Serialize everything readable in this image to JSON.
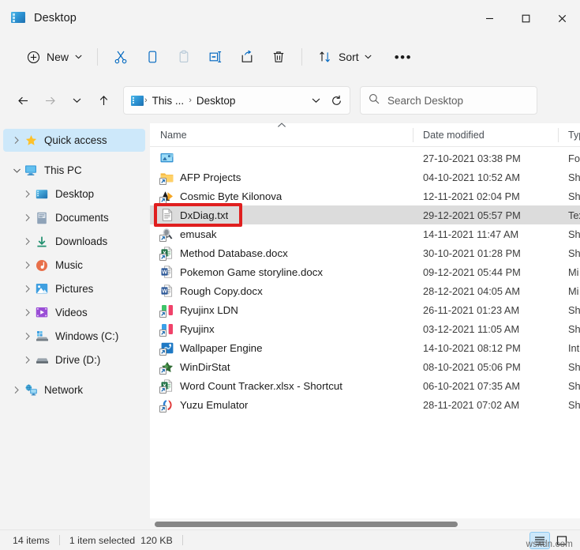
{
  "window": {
    "title": "Desktop",
    "icon": "desktop-icon",
    "minimize_label": "Minimize",
    "maximize_label": "Maximize",
    "close_label": "Close"
  },
  "toolbar": {
    "new_label": "New",
    "sort_label": "Sort",
    "cut_label": "Cut",
    "copy_label": "Copy",
    "paste_label": "Paste",
    "rename_label": "Rename",
    "share_label": "Share",
    "delete_label": "Delete",
    "more_label": "See more"
  },
  "navbar": {
    "back_label": "Back",
    "forward_label": "Forward",
    "recent_label": "Recent locations",
    "up_label": "Up",
    "refresh_label": "Refresh",
    "breadcrumb": [
      "This ...",
      "Desktop"
    ],
    "separator": "›"
  },
  "search": {
    "placeholder": "Search Desktop",
    "value": ""
  },
  "sidebar": {
    "items": [
      {
        "label": "Quick access",
        "icon": "star-icon",
        "level": 1,
        "expanded": false,
        "selected": true
      },
      {
        "label": "This PC",
        "icon": "this-pc-icon",
        "level": 1,
        "expanded": true,
        "selected": false
      },
      {
        "label": "Desktop",
        "icon": "desktop-icon",
        "level": 2,
        "expanded": false,
        "selected": false
      },
      {
        "label": "Documents",
        "icon": "documents-icon",
        "level": 2,
        "expanded": false,
        "selected": false
      },
      {
        "label": "Downloads",
        "icon": "downloads-icon",
        "level": 2,
        "expanded": false,
        "selected": false
      },
      {
        "label": "Music",
        "icon": "music-icon",
        "level": 2,
        "expanded": false,
        "selected": false
      },
      {
        "label": "Pictures",
        "icon": "pictures-icon",
        "level": 2,
        "expanded": false,
        "selected": false
      },
      {
        "label": "Videos",
        "icon": "videos-icon",
        "level": 2,
        "expanded": false,
        "selected": false
      },
      {
        "label": "Windows (C:)",
        "icon": "drive-icon",
        "level": 2,
        "expanded": false,
        "selected": false
      },
      {
        "label": "Drive (D:)",
        "icon": "drive-icon",
        "level": 2,
        "expanded": false,
        "selected": false
      },
      {
        "label": "Network",
        "icon": "network-icon",
        "level": 1,
        "expanded": false,
        "selected": false
      }
    ]
  },
  "filelist": {
    "columns": [
      {
        "label": "Name",
        "sort": "ascending"
      },
      {
        "label": "Date modified",
        "sort": ""
      },
      {
        "label": "Typ",
        "sort": ""
      }
    ],
    "rows": [
      {
        "name": "",
        "date": "27-10-2021 03:38 PM",
        "type": "Fol",
        "icon": "remote-desktop-icon",
        "selected": false,
        "shortcut": false
      },
      {
        "name": "AFP Projects",
        "date": "04-10-2021 10:52 AM",
        "type": "Sh",
        "icon": "folder-icon",
        "selected": false,
        "shortcut": true
      },
      {
        "name": "Cosmic Byte Kilonova",
        "date": "12-11-2021 02:04 PM",
        "type": "Sh",
        "icon": "cosmic-byte-icon",
        "selected": false,
        "shortcut": true
      },
      {
        "name": "DxDiag.txt",
        "date": "29-12-2021 05:57 PM",
        "type": "Tex",
        "icon": "text-file-icon",
        "selected": true,
        "shortcut": false
      },
      {
        "name": "emusak",
        "date": "14-11-2021 11:47 AM",
        "type": "Sh",
        "icon": "emusak-icon",
        "selected": false,
        "shortcut": true
      },
      {
        "name": "Method Database.docx",
        "date": "30-10-2021 01:28 PM",
        "type": "Sh",
        "icon": "excel-doc-icon",
        "selected": false,
        "shortcut": true
      },
      {
        "name": "Pokemon Game storyline.docx",
        "date": "09-12-2021 05:44 PM",
        "type": "Mi",
        "icon": "word-doc-icon",
        "selected": false,
        "shortcut": false
      },
      {
        "name": "Rough Copy.docx",
        "date": "28-12-2021 04:05 AM",
        "type": "Mi",
        "icon": "word-doc-icon",
        "selected": false,
        "shortcut": false
      },
      {
        "name": "Ryujinx LDN",
        "date": "26-11-2021 01:23 AM",
        "type": "Sh",
        "icon": "ryujinx-ldn-icon",
        "selected": false,
        "shortcut": true
      },
      {
        "name": "Ryujinx",
        "date": "03-12-2021 11:05 AM",
        "type": "Sh",
        "icon": "ryujinx-icon",
        "selected": false,
        "shortcut": true
      },
      {
        "name": "Wallpaper Engine",
        "date": "14-10-2021 08:12 PM",
        "type": "Int",
        "icon": "wallpaper-engine-icon",
        "selected": false,
        "shortcut": true
      },
      {
        "name": "WinDirStat",
        "date": "08-10-2021 05:06 PM",
        "type": "Sh",
        "icon": "windirstat-icon",
        "selected": false,
        "shortcut": true
      },
      {
        "name": "Word Count Tracker.xlsx - Shortcut",
        "date": "06-10-2021 07:35 AM",
        "type": "Sh",
        "icon": "excel-doc-icon",
        "selected": false,
        "shortcut": true
      },
      {
        "name": "Yuzu Emulator",
        "date": "28-11-2021 07:02 AM",
        "type": "Sh",
        "icon": "yuzu-icon",
        "selected": false,
        "shortcut": true
      }
    ]
  },
  "statusbar": {
    "item_count": "14 items",
    "selection": "1 item selected",
    "selection_size": "120 KB",
    "view_details_label": "Details view",
    "view_large_label": "Large icons view"
  },
  "watermark": "wsxdn.com",
  "annotation": {
    "color": "#e01f1f",
    "target": "DxDiag.txt"
  },
  "colors": {
    "accent": "#0067c0",
    "selection": "#cde8fa",
    "row_selected": "#dcdcdc",
    "chrome": "#f3f3f3"
  }
}
